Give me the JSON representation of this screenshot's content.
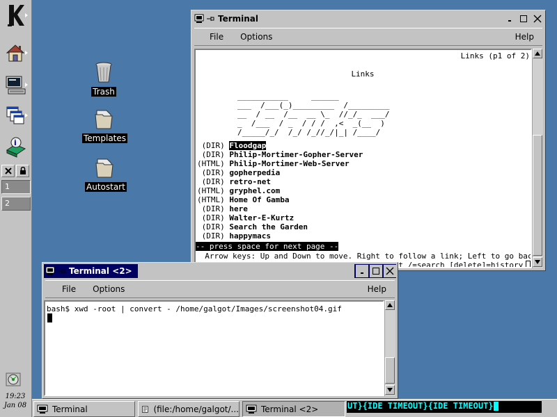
{
  "panel": {
    "desktops": [
      "1",
      "2"
    ],
    "clock": {
      "time": "19:23",
      "date": "Jan 08"
    }
  },
  "desktop_icons": [
    {
      "label": "Trash"
    },
    {
      "label": "Templates"
    },
    {
      "label": "Autostart"
    }
  ],
  "window_main": {
    "title": "Terminal",
    "menu": {
      "file": "File",
      "options": "Options",
      "help": "Help"
    },
    "page_header": "Links (p1 of 2)",
    "heading": "Links",
    "ascii_art": [
      "___________     ______",
      "___  /___(_)_________  /_________",
      "__  / __  /__  __ \\_  //_/_  ___/",
      "_  /___  / _  / / /  ,<  _(__  )",
      "/_____/_/  /_/ /_//_/|_| /____/"
    ],
    "items": [
      {
        "type": " (DIR)",
        "name": "Floodgap",
        "selected": true
      },
      {
        "type": " (DIR)",
        "name": "Philip-Mortimer-Gopher-Server",
        "selected": false
      },
      {
        "type": "(HTML)",
        "name": "Philip-Mortimer-Web-Server",
        "selected": false
      },
      {
        "type": " (DIR)",
        "name": "gopherpedia",
        "selected": false
      },
      {
        "type": " (DIR)",
        "name": "retro-net",
        "selected": false
      },
      {
        "type": "(HTML)",
        "name": "gryphel.com",
        "selected": false
      },
      {
        "type": "(HTML)",
        "name": "Home Of Gamba",
        "selected": false
      },
      {
        "type": " (DIR)",
        "name": "here",
        "selected": false
      },
      {
        "type": " (DIR)",
        "name": "Walter-E-Kurtz",
        "selected": false
      },
      {
        "type": " (DIR)",
        "name": "Search the Garden",
        "selected": false
      },
      {
        "type": " (DIR)",
        "name": "happymacs",
        "selected": false
      }
    ],
    "status_bar": "-- press space for next page --",
    "help_line1": "  Arrow keys: Up and Down to move. Right to follow a link; Left to go back.",
    "help_line2": " H)elp O)ptions P)rint G)o M)ain screen Q)uit /=search [delete]=history list"
  },
  "window_second": {
    "title": "Terminal <2>",
    "menu": {
      "file": "File",
      "options": "Options",
      "help": "Help"
    },
    "command_line": "bash$ xwd -root | convert - /home/galgot/Images/screenshot04.gif"
  },
  "taskbar": {
    "tasks": [
      {
        "label": "Terminal"
      },
      {
        "label": "(file:/home/galgot/..."
      },
      {
        "label": "Terminal <2>"
      }
    ],
    "ticker": "UT}{IDE TIMEOUT}{IDE TIMEOUT}"
  }
}
